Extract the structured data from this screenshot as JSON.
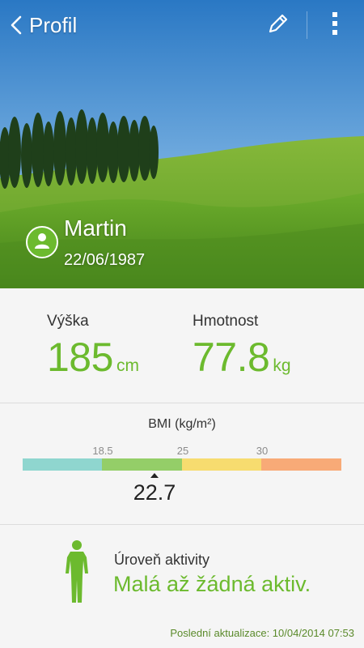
{
  "header": {
    "back_label": "Profil"
  },
  "profile": {
    "name": "Martin",
    "date_of_birth": "22/06/1987"
  },
  "stats": {
    "height": {
      "label": "Výška",
      "value": "185",
      "unit": "cm"
    },
    "weight": {
      "label": "Hmotnost",
      "value": "77.8",
      "unit": "kg"
    }
  },
  "bmi": {
    "title": "BMI (kg/m²)",
    "ticks": [
      "18.5",
      "25",
      "30"
    ],
    "segment_colors": [
      "#8fd6cf",
      "#94ce68",
      "#f7dc6f",
      "#f8aa77"
    ],
    "value": "22.7"
  },
  "activity": {
    "label": "Úroveň aktivity",
    "value": "Malá až žádná aktiv."
  },
  "footer": {
    "last_update": "Poslední aktualizace: 10/04/2014 07:53"
  },
  "colors": {
    "accent": "#6cba2e"
  },
  "icons": {
    "back": "chevron-left-icon",
    "edit": "pencil-icon",
    "more": "more-vertical-icon",
    "avatar": "user-icon",
    "activity": "standing-person-icon"
  }
}
